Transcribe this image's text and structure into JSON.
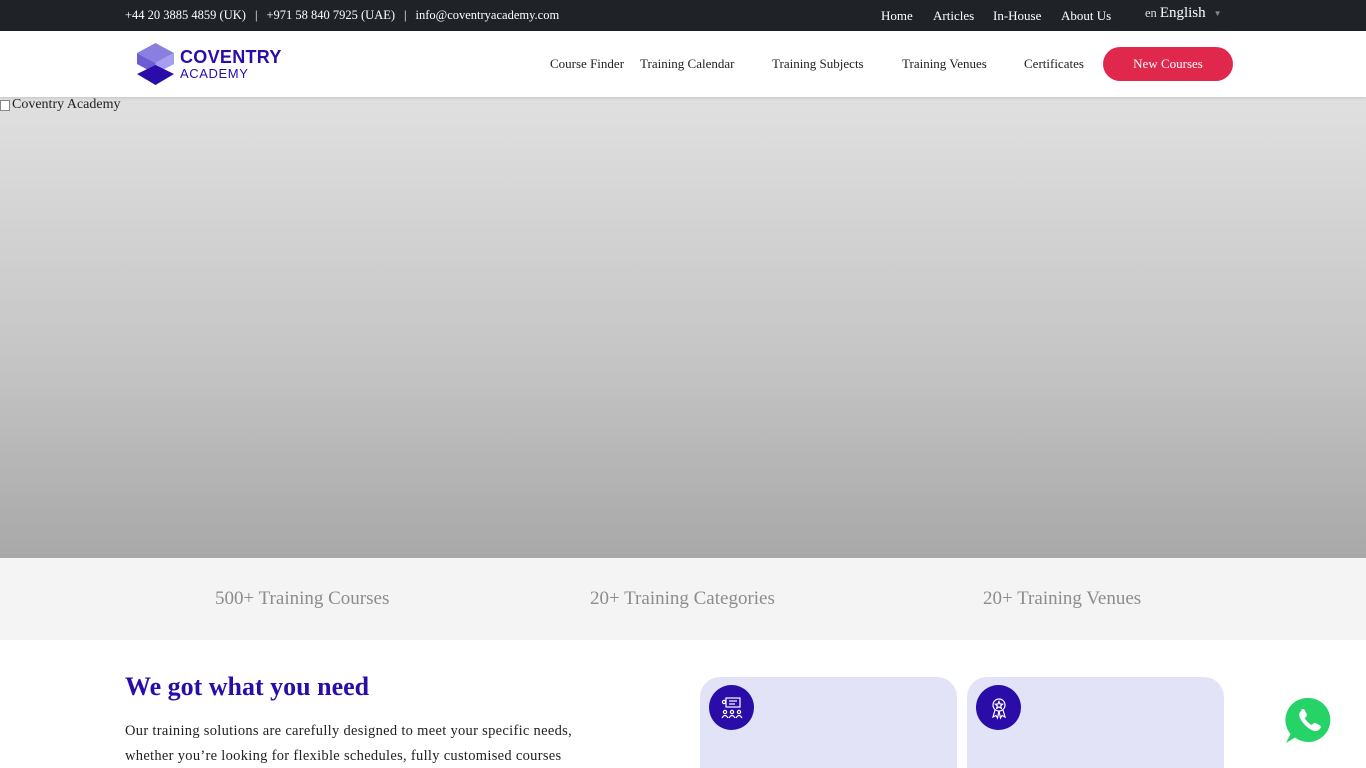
{
  "topbar": {
    "phone_uk": "+44 20 3885 4859 (UK)",
    "separator": "|",
    "phone_uae": "+971 58 840 7925 (UAE)",
    "email": "info@coventryacademy.com",
    "nav": [
      "Home",
      "Articles",
      "In-House",
      "About Us"
    ],
    "language": {
      "flag_alt": "en",
      "label": "English",
      "caret": "▼"
    }
  },
  "brand": {
    "line1": "COVENTRY",
    "line2": "ACADEMY"
  },
  "mainnav": {
    "items": [
      "Course Finder",
      "Training Calendar",
      "Training Subjects",
      "Training Venues",
      "Certificates"
    ],
    "cta": "New Courses"
  },
  "hero": {
    "image_alt": "Coventry Academy"
  },
  "stats": [
    "500+ Training Courses",
    "20+ Training Categories",
    "20+ Training Venues"
  ],
  "intro": {
    "title": "We got what you need",
    "text": "Our training solutions are carefully designed to meet your specific needs, whether you’re looking for flexible schedules, fully customised courses"
  },
  "cards": [
    {
      "icon": "training-group-icon"
    },
    {
      "icon": "certificate-badge-icon"
    }
  ],
  "floating": {
    "icon": "whatsapp-icon"
  },
  "colors": {
    "brand": "#2a0ca8",
    "accent": "#e0284d",
    "topbar_bg": "#1f2328",
    "card_bg": "#e2e3f7",
    "whatsapp": "#25d366"
  }
}
